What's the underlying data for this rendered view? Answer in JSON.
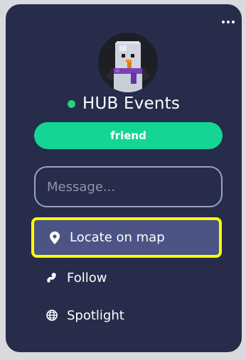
{
  "profile": {
    "name": "HUB Events",
    "status_color": "#2bd17f",
    "avatar_icon": "snowman-avatar"
  },
  "menu": {
    "more_icon": "ellipsis-icon"
  },
  "friend_button": {
    "label": "friend"
  },
  "message": {
    "placeholder": "Message...",
    "value": ""
  },
  "actions": [
    {
      "label": "Locate on map",
      "icon": "map-pin-icon"
    },
    {
      "label": "Follow",
      "icon": "follow-icon"
    },
    {
      "label": "Spotlight",
      "icon": "globe-icon"
    }
  ],
  "colors": {
    "panel": "#262c4a",
    "accent": "#15d596",
    "highlight": "#ffff00"
  }
}
